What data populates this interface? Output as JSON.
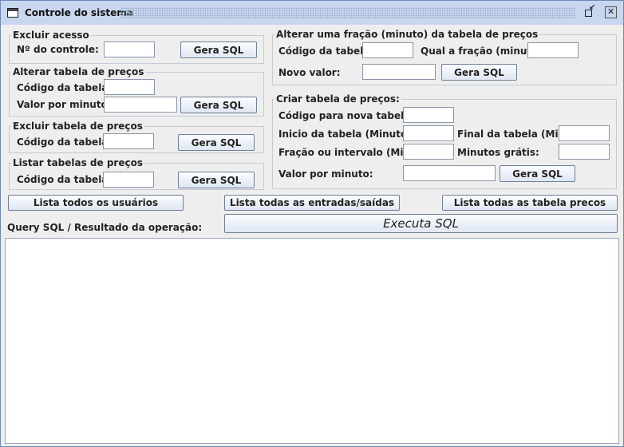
{
  "window": {
    "title": "Controle do sistema"
  },
  "excluir_acesso": {
    "legend": "Excluir acesso",
    "controle_label": "Nº do controle:",
    "controle_value": "",
    "button": "Gera SQL"
  },
  "alterar_tabela": {
    "legend": "Alterar tabela de preços",
    "codigo_label": "Código da tabela:",
    "codigo_value": "",
    "valor_label": "Valor por minuto:",
    "valor_value": "",
    "button": "Gera SQL"
  },
  "excluir_tabela": {
    "legend": "Excluir tabela de preços",
    "codigo_label": "Código da tabela:",
    "codigo_value": "",
    "button": "Gera SQL"
  },
  "listar_tabelas": {
    "legend": "Listar tabelas de preços",
    "codigo_label": "Código da tabela:",
    "codigo_value": "",
    "button": "Gera SQL"
  },
  "alterar_fracao": {
    "legend": "Alterar uma fração (minuto) da tabela de preços",
    "codigo_label": "Código da tabela:",
    "codigo_value": "",
    "fracao_label": "Qual a fração (minuto):",
    "fracao_value": "",
    "novo_label": "Novo valor:",
    "novo_value": "",
    "button": "Gera SQL"
  },
  "criar_tabela": {
    "legend": "Criar tabela de preços:",
    "codigo_label": "Código para nova tabela:",
    "codigo_value": "",
    "inicio_label": "Inicio da tabela (Minutos):",
    "inicio_value": "",
    "final_label": "Final da tabela (Min.):",
    "final_value": "",
    "fracao_label": "Fração ou intervalo (Min.):",
    "fracao_value": "",
    "gratis_label": "Minutos grátis:",
    "gratis_value": "",
    "valor_label": "Valor por minuto:",
    "valor_value": "",
    "button": "Gera SQL"
  },
  "actions": {
    "lista_usuarios": "Lista todos os usuários",
    "lista_entradas": "Lista todas as entradas/saídas",
    "lista_tabelas": "Lista todas as tabela precos",
    "query_label": "Query SQL / Resultado da operação:",
    "executa": "Executa SQL"
  },
  "result_text": ""
}
